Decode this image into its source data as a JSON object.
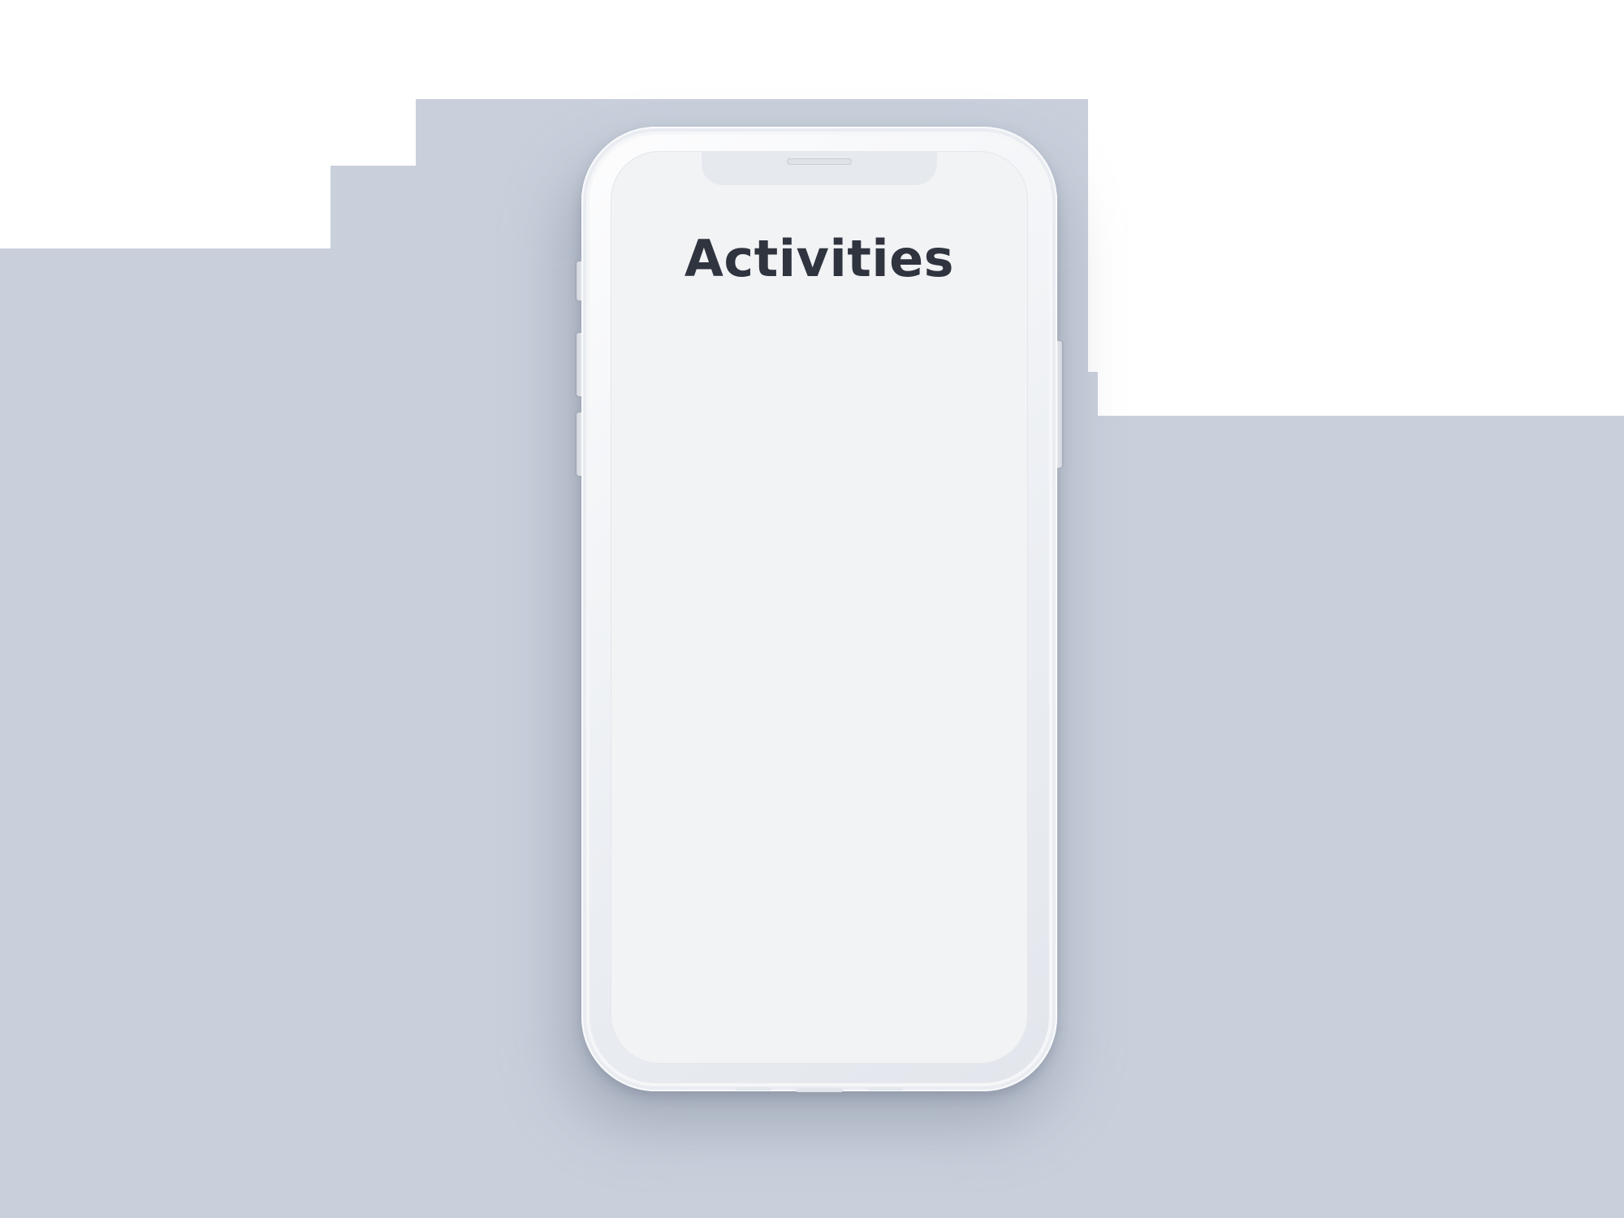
{
  "screen": {
    "title": "Activities"
  },
  "colors": {
    "backdrop": "#c9d0dc",
    "screen_background": "#f2f3f5",
    "title_text": "#2f343f",
    "phone_body": "#eceff3"
  },
  "device": {
    "type": "smartphone-mockup"
  }
}
